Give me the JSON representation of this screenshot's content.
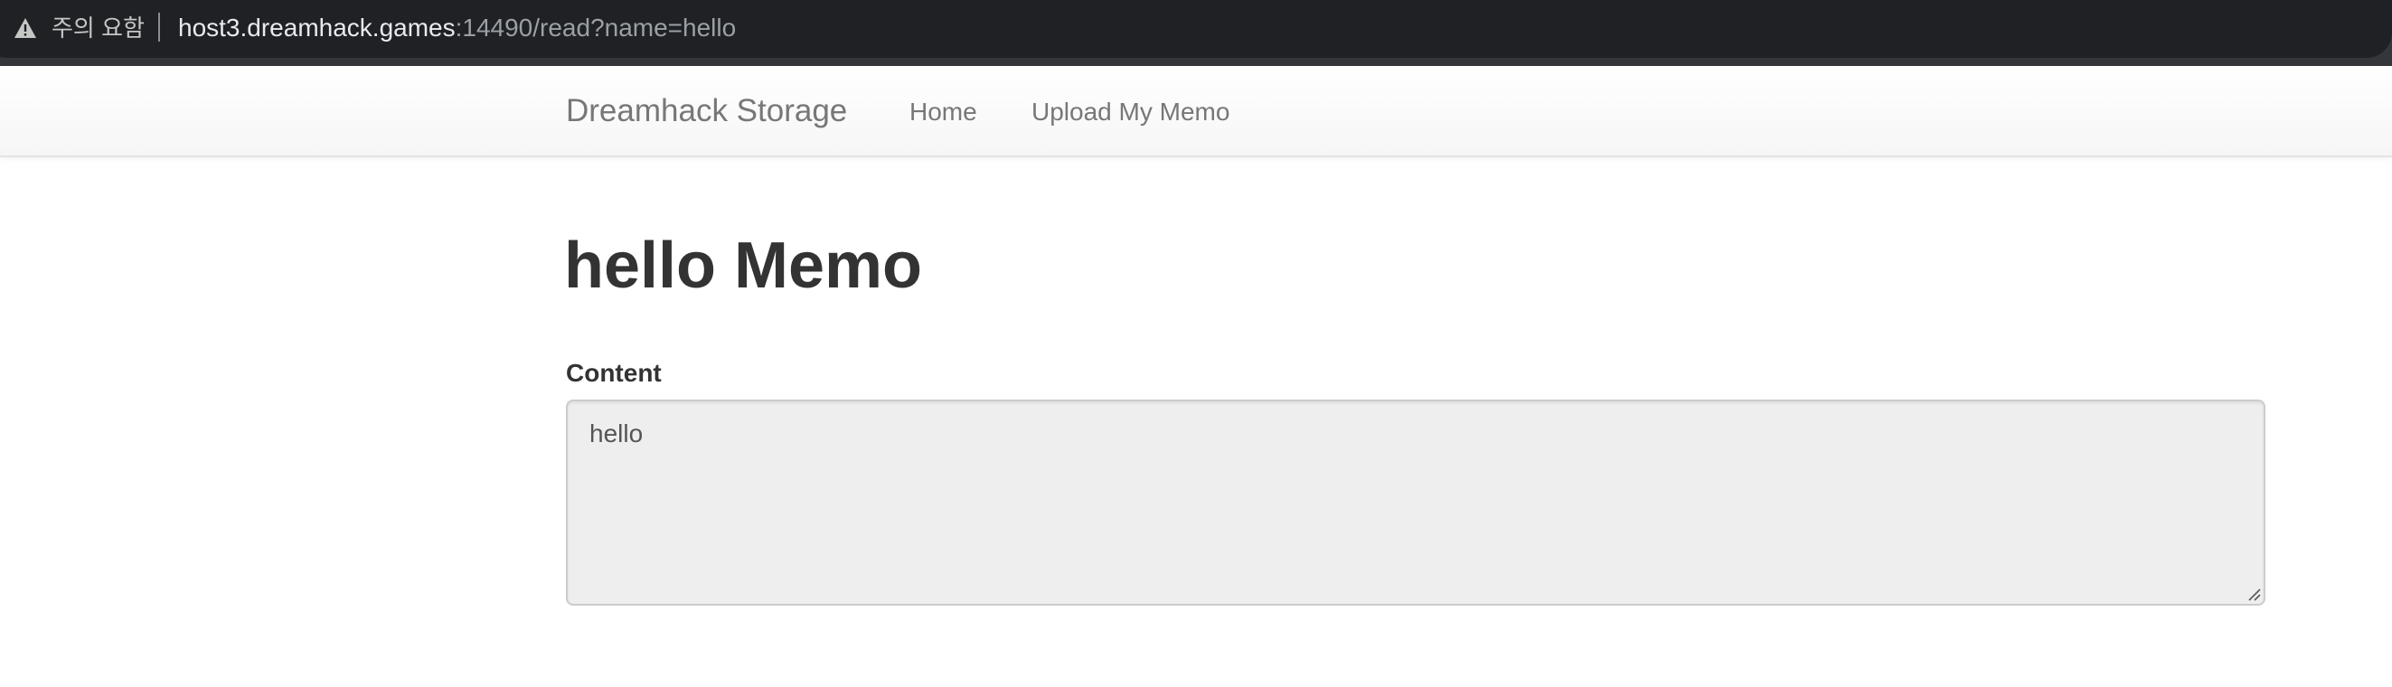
{
  "browser": {
    "security_label": "주의 요함",
    "url_host": "host3.dreamhack.games",
    "url_rest": ":14490/read?name=hello",
    "warning_icon": "warning-triangle-icon"
  },
  "navbar": {
    "brand": "Dreamhack Storage",
    "items": [
      {
        "label": "Home"
      },
      {
        "label": "Upload My Memo"
      }
    ]
  },
  "main": {
    "title": "hello Memo",
    "content_label": "Content",
    "content_value": "hello"
  },
  "colors": {
    "addressbar_bg": "#202124",
    "nav_text": "#777777",
    "heading_text": "#333333",
    "memo_bg": "#eeeeee"
  }
}
